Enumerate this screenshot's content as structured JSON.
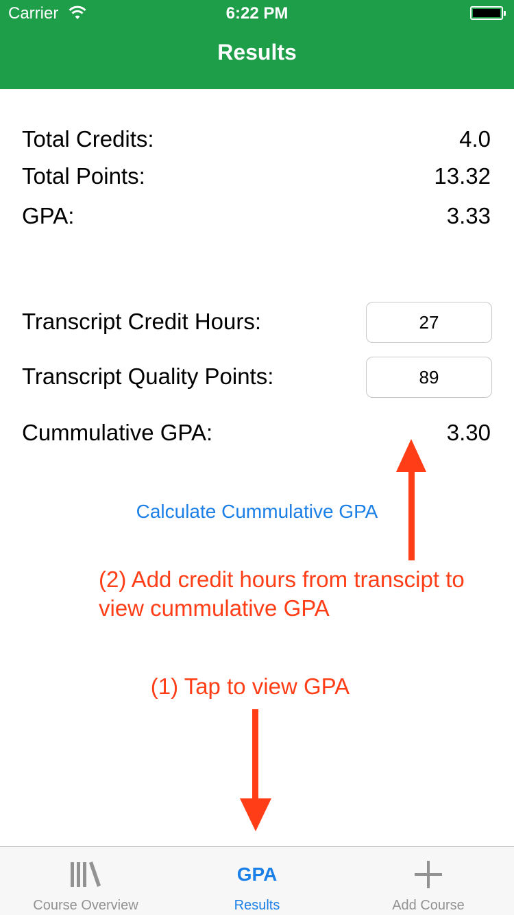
{
  "status_bar": {
    "carrier": "Carrier",
    "time": "6:22 PM"
  },
  "nav": {
    "title": "Results"
  },
  "summary": {
    "total_credits_label": "Total Credits:",
    "total_credits_value": "4.0",
    "total_points_label": "Total Points:",
    "total_points_value": "13.32",
    "gpa_label": "GPA:",
    "gpa_value": "3.33"
  },
  "transcript": {
    "credit_hours_label": "Transcript Credit Hours:",
    "credit_hours_value": "27",
    "quality_points_label": "Transcript Quality Points:",
    "quality_points_value": "89",
    "cumulative_label": "Cummulative GPA:",
    "cumulative_value": "3.30"
  },
  "calculate_button": "Calculate Cummulative GPA",
  "annotations": {
    "note2_line1": "(2) Add credit hours from transcipt to",
    "note2_line2": "view cummulative GPA",
    "note1": "(1) Tap to view GPA",
    "color": "#ff3e17"
  },
  "tabbar": {
    "tabs": [
      {
        "label": "Course Overview",
        "icon": "books-icon"
      },
      {
        "label": "Results",
        "icon_text": "GPA",
        "active": true
      },
      {
        "label": "Add Course",
        "icon": "plus-icon"
      }
    ]
  },
  "colors": {
    "nav": "#1f9e4a",
    "accent": "#1a7fe6"
  }
}
